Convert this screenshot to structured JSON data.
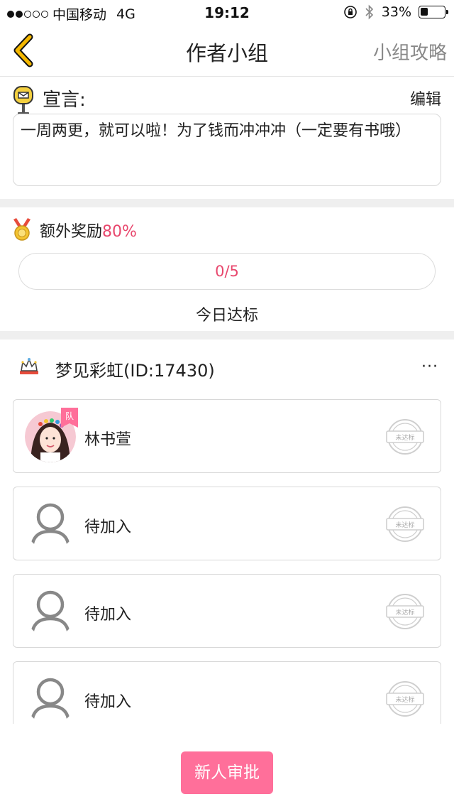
{
  "status_bar": {
    "carrier": "中国移动",
    "network": "4G",
    "time": "19:12",
    "battery": "33%",
    "battery_level": 0.33,
    "signal_bars_filled": 2,
    "signal_bars_total": 5,
    "icons": [
      "rotation-lock-icon",
      "bluetooth-icon",
      "battery-icon"
    ]
  },
  "nav": {
    "back_icon": "chevron-left-icon",
    "title": "作者小组",
    "right_link": "小组攻略"
  },
  "manifesto": {
    "icon": "mailbox-icon",
    "label": "宣言:",
    "edit_label": "编辑",
    "text": "一周两更，就可以啦！为了钱而冲冲冲（一定要有书哦）"
  },
  "bonus": {
    "icon": "medal-icon",
    "label": "额外奖励",
    "percent": "80%",
    "progress_text": "0/5",
    "progress_fraction": 0,
    "status_text": "今日达标"
  },
  "team": {
    "icon": "crown-icon",
    "name": "梦见彩虹(ID:17430)",
    "more": "···",
    "members": [
      {
        "name": "林书萱",
        "badge": "队",
        "stamp": "未达标",
        "has_photo": true
      },
      {
        "name": "待加入",
        "stamp": "未达标",
        "has_photo": false
      },
      {
        "name": "待加入",
        "stamp": "未达标",
        "has_photo": false
      },
      {
        "name": "待加入",
        "stamp": "未达标",
        "has_photo": false
      }
    ]
  },
  "footer": {
    "approve_button": "新人审批"
  },
  "colors": {
    "accent": "#ff6f9a",
    "accent_text": "#e8476d",
    "back_arrow": "#f5b800",
    "divider": "#efefef",
    "border": "#d8d8d8"
  }
}
